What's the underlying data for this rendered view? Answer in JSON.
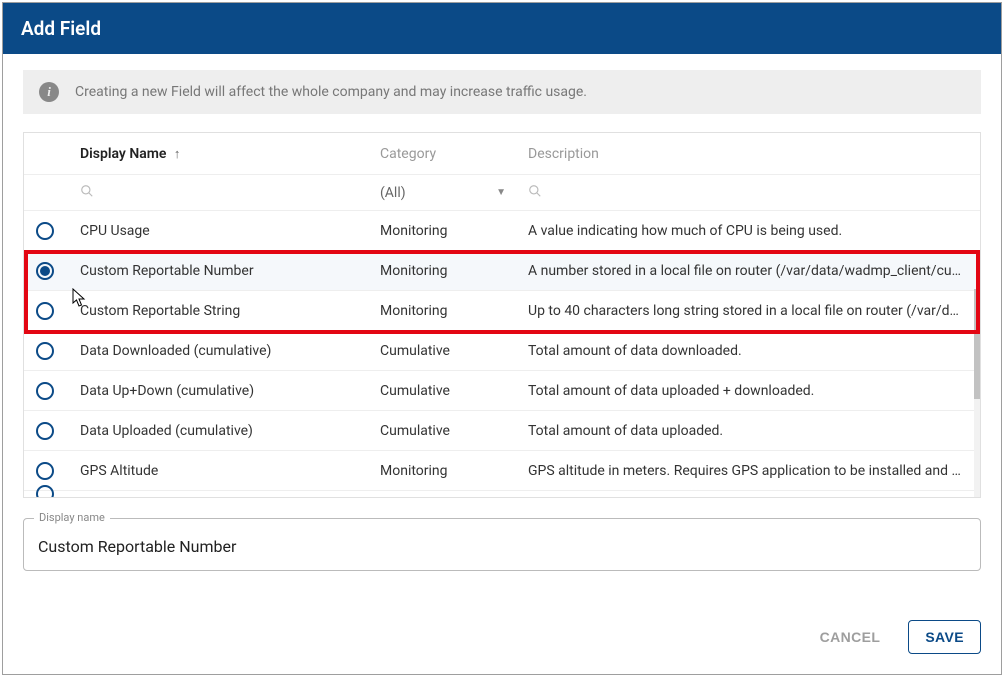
{
  "dialog": {
    "title": "Add Field",
    "info": "Creating a new Field will affect the whole company and may increase traffic usage."
  },
  "table": {
    "headers": {
      "display_name": "Display Name",
      "category": "Category",
      "description": "Description"
    },
    "sort_indicator": "↑",
    "filter_category": "(All)",
    "rows": [
      {
        "name": "CPU Usage",
        "category": "Monitoring",
        "desc": "A value indicating how much of CPU is being used.",
        "selected": false
      },
      {
        "name": "Custom Reportable Number",
        "category": "Monitoring",
        "desc": "A number stored in a local file on router (/var/data/wadmp_client/cust…",
        "selected": true
      },
      {
        "name": "Custom Reportable String",
        "category": "Monitoring",
        "desc": "Up to 40 characters long string stored in a local file on router (/var/dat…",
        "selected": false
      },
      {
        "name": "Data Downloaded (cumulative)",
        "category": "Cumulative",
        "desc": "Total amount of data downloaded.",
        "selected": false
      },
      {
        "name": "Data Up+Down (cumulative)",
        "category": "Cumulative",
        "desc": "Total amount of data uploaded + downloaded.",
        "selected": false
      },
      {
        "name": "Data Uploaded (cumulative)",
        "category": "Cumulative",
        "desc": "Total amount of data uploaded.",
        "selected": false
      },
      {
        "name": "GPS Altitude",
        "category": "Monitoring",
        "desc": "GPS altitude in meters. Requires GPS application to be installed and en…",
        "selected": false
      }
    ]
  },
  "form": {
    "display_name_label": "Display name",
    "display_name_value": "Custom Reportable Number"
  },
  "footer": {
    "cancel": "CANCEL",
    "save": "SAVE"
  }
}
